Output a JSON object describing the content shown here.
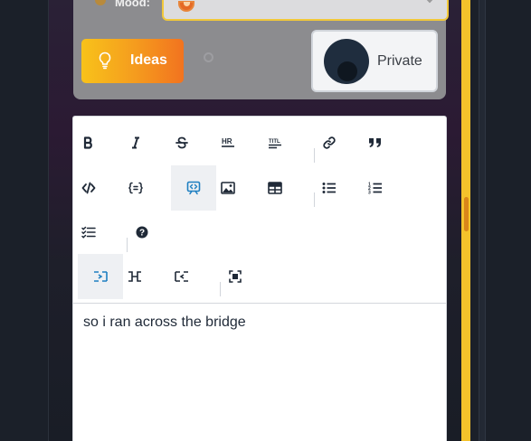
{
  "mood": {
    "label": "Mood:",
    "selected_icon": "orange-smiley-icon"
  },
  "ideas_button": {
    "label": "Ideas",
    "icon": "lightbulb-icon"
  },
  "privacy_toggle": {
    "label": "Private",
    "state": "on"
  },
  "toolbar": {
    "rows": [
      [
        "bold-icon",
        "italic-icon",
        "strikethrough-icon",
        "horizontal-rule-icon",
        "title-icon",
        "link-icon",
        "quote-icon"
      ],
      [
        "code-icon",
        "code-block-icon",
        "preview-icon",
        "image-icon",
        "table-icon",
        "unordered-list-icon",
        "ordered-list-icon"
      ],
      [
        "checklist-icon",
        "help-icon"
      ],
      [
        "side-by-side-left-icon",
        "side-by-side-icon",
        "side-by-side-right-icon",
        "fullscreen-icon"
      ]
    ]
  },
  "editor": {
    "content": "so i ran across the bridge"
  },
  "colors": {
    "accent": "#f4c22b",
    "ideas_gradient_start": "#f8c21a",
    "ideas_gradient_end": "#f2731f",
    "active_icon": "#1e7fc1"
  }
}
